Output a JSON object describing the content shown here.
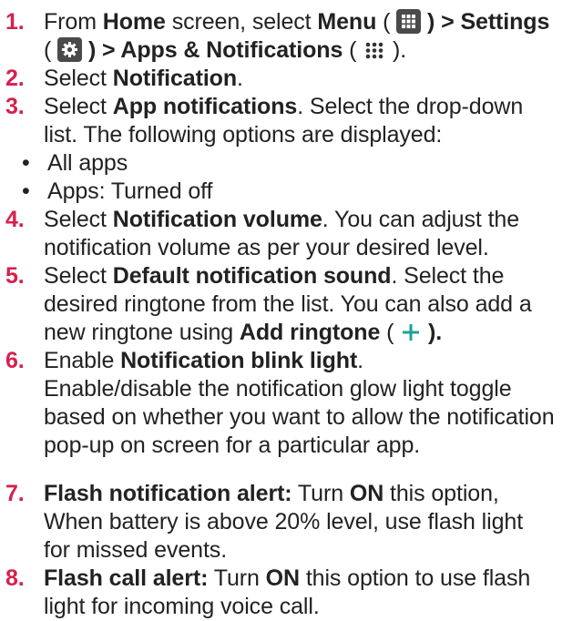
{
  "steps": [
    {
      "number": "1.",
      "t1": "From ",
      "b1": "Home",
      "t2": " screen, select ",
      "b2": "Menu",
      "t3": " ( ",
      "t4": " ",
      "b3": ") > Settings",
      "t5": "( ",
      "b4": ") > Apps & Notifications",
      "t6": " ( ",
      "t7": " )."
    },
    {
      "number": "2.",
      "t1": "Select ",
      "b1": "Notification",
      "t2": "."
    },
    {
      "number": "3.",
      "t1": "Select ",
      "b1": "App notifications",
      "t2": ". Select the drop-down",
      "t3": "list. The following options are displayed:",
      "bullets": [
        "All apps",
        "Apps: Turned off"
      ]
    },
    {
      "number": "4.",
      "t1": "Select ",
      "b1": "Notification volume",
      "t2": ". You can adjust the",
      "t3": "notification volume as per your desired level."
    },
    {
      "number": "5.",
      "t1": "Select ",
      "b1": "Default notification sound",
      "t2": ". Select the",
      "t3": "desired ringtone from the list. You can also add a",
      "t4": "new ringtone using ",
      "b2": "Add ringtone",
      "t5": " ( ",
      "t6": " ",
      "b3": ")."
    },
    {
      "number": "6.",
      "t1": "Enable ",
      "b1": "Notification blink light",
      "t2": ".",
      "t3": "Enable/disable the notification glow light toggle",
      "t4": "based on whether you want to allow the notification",
      "t5": "pop-up on screen for a particular app."
    },
    {
      "number": "7.",
      "b1": "Flash notification alert:",
      "t1": " Turn ",
      "b2": "ON",
      "t2": " this option,",
      "t3": "When battery is above 20% level, use flash light",
      "t4": "for missed events."
    },
    {
      "number": "8.",
      "b1": "Flash call alert:",
      "t1": " Turn ",
      "b2": "ON",
      "t2": " this option to use flash",
      "t3": "light for incoming voice call."
    }
  ],
  "colors": {
    "step_number": "#d6204f",
    "text": "#222222",
    "icon_box": "#4a4a4a",
    "plus": "#1aa39a"
  },
  "icons": {
    "menu": "grid-menu-icon",
    "settings": "gear-icon",
    "apps": "apps-dots-icon",
    "add": "plus-icon"
  }
}
